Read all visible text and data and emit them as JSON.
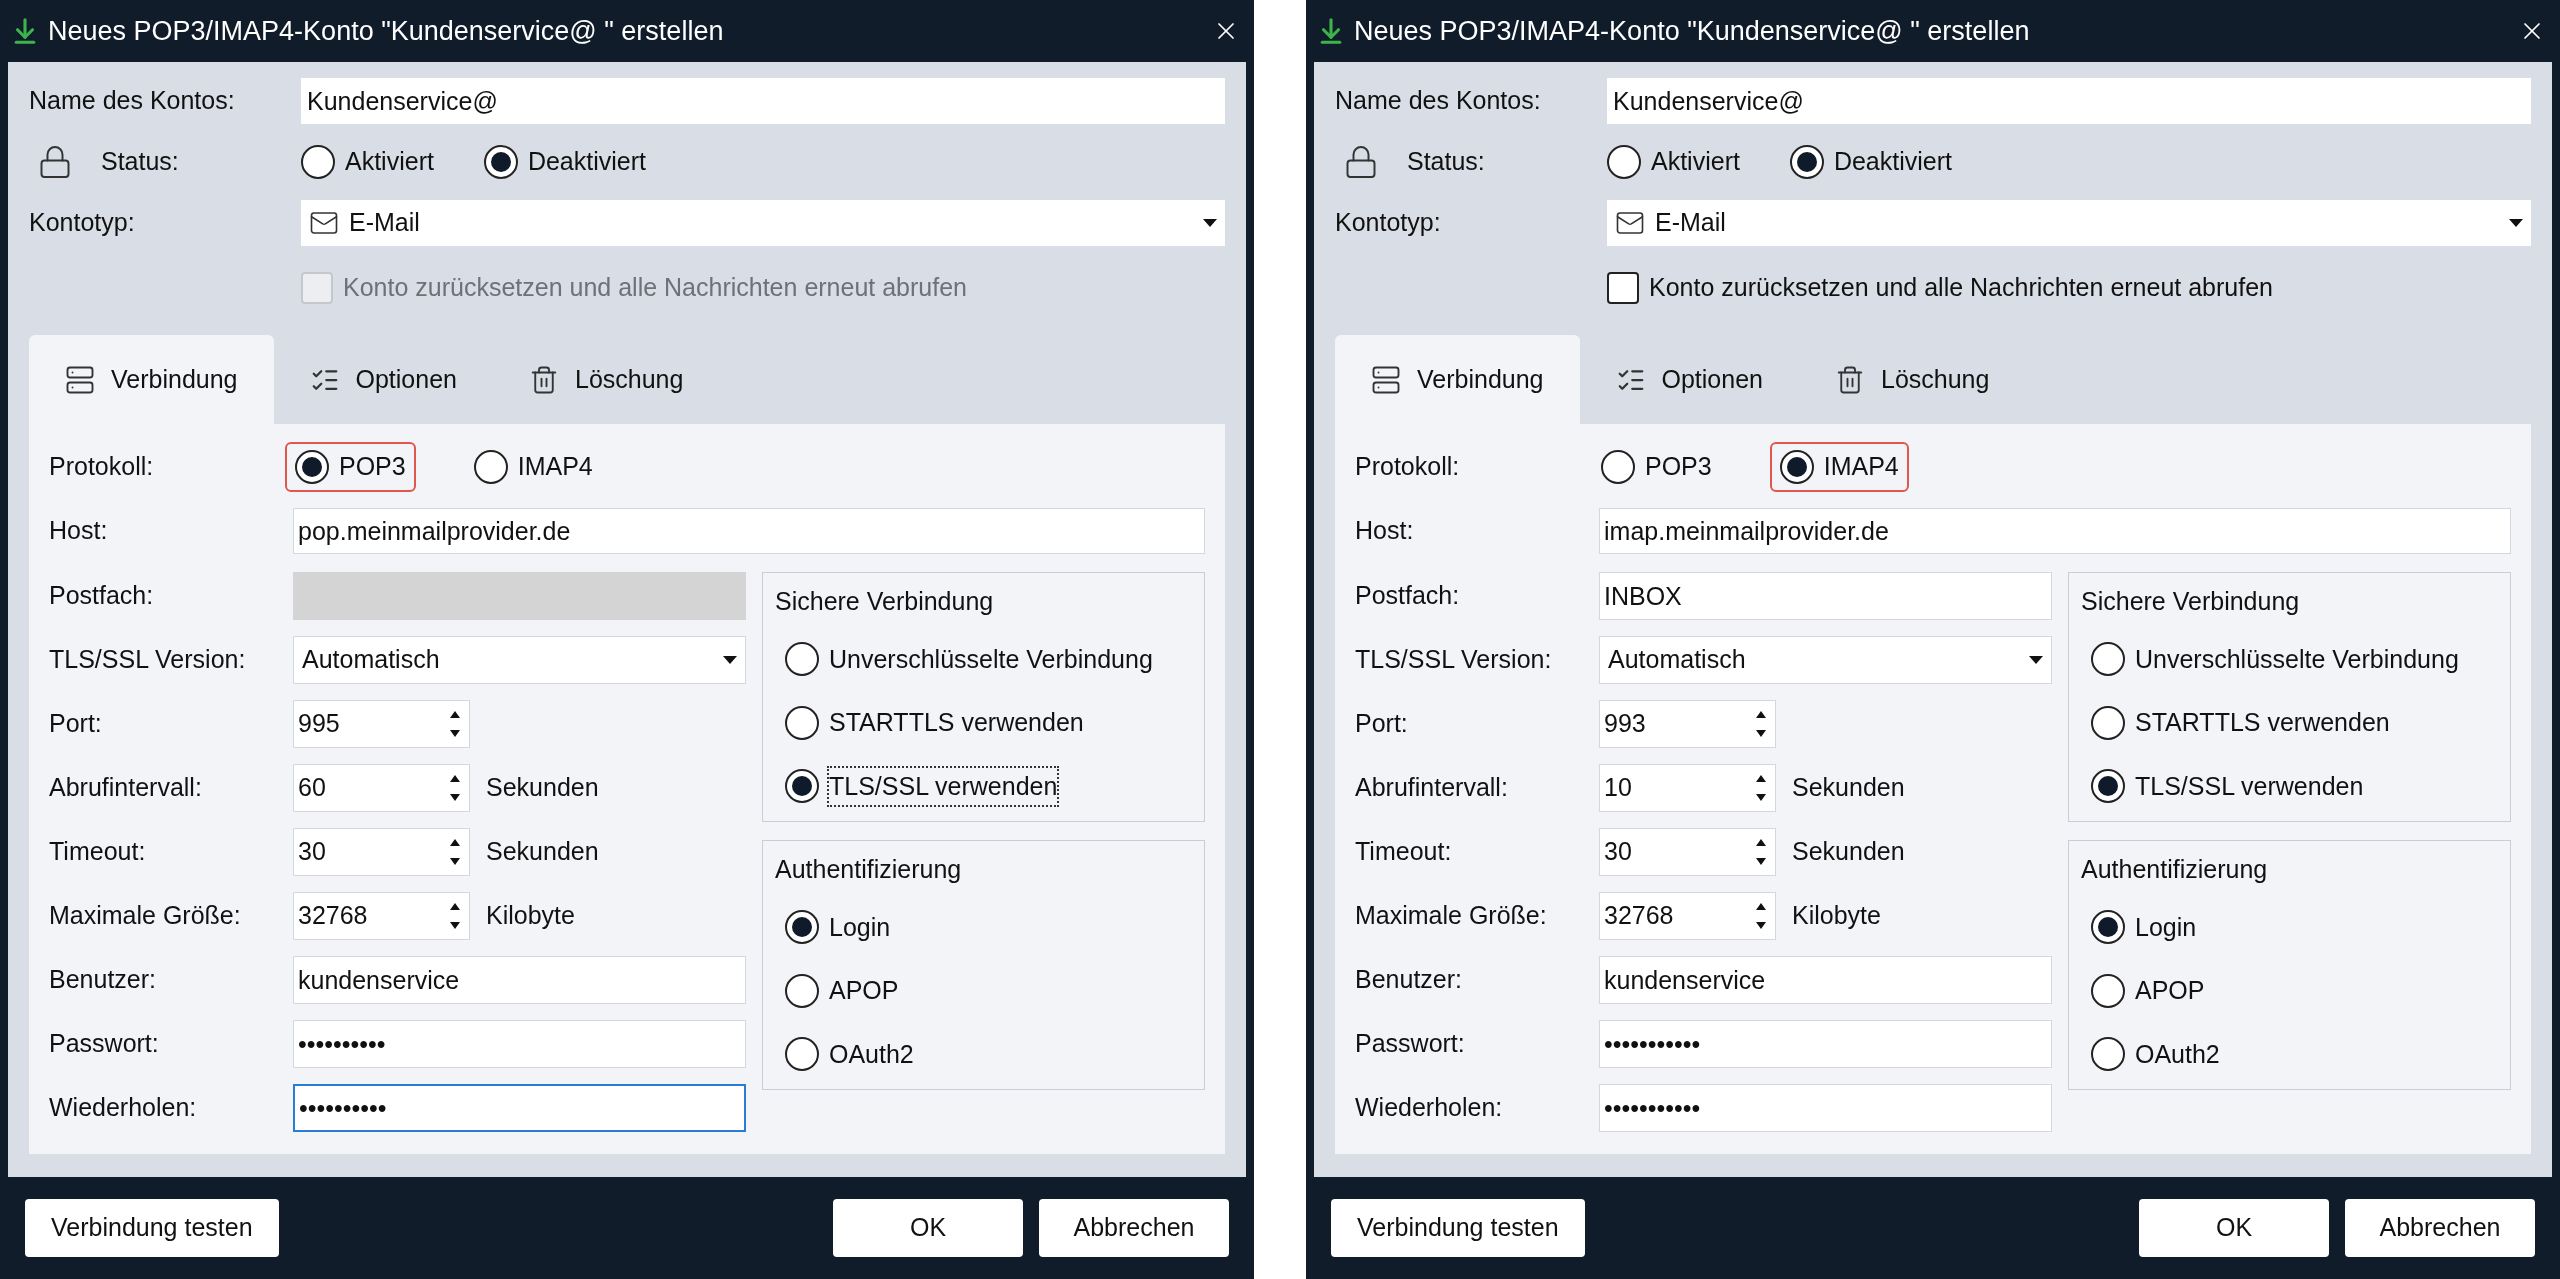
{
  "dialogs": [
    {
      "title": "Neues POP3/IMAP4-Konto \"Kundenservice@ \" erstellen",
      "account_name": {
        "label": "Name des Kontos:",
        "value": "Kundenservice@"
      },
      "status": {
        "label": "Status:",
        "options": [
          {
            "label": "Aktiviert",
            "selected": false
          },
          {
            "label": "Deaktiviert",
            "selected": true
          }
        ]
      },
      "account_type": {
        "label": "Kontotyp:",
        "value": "E-Mail"
      },
      "reset": {
        "label": "Konto zurücksetzen und alle Nachrichten erneut abrufen",
        "checked": false,
        "disabled": true
      },
      "tabs": [
        {
          "kind": "connection",
          "label": "Verbindung",
          "selected": true
        },
        {
          "kind": "options",
          "label": "Optionen",
          "selected": false
        },
        {
          "kind": "deletion",
          "label": "Löschung",
          "selected": false
        }
      ],
      "protocol": {
        "label": "Protokoll:",
        "options": [
          {
            "label": "POP3",
            "selected": true,
            "highlighted": true
          },
          {
            "label": "IMAP4",
            "selected": false,
            "highlighted": false
          }
        ]
      },
      "host": {
        "label": "Host:",
        "value": "pop.meinmailprovider.de"
      },
      "fields": [
        {
          "kind": "text",
          "label": "Postfach:",
          "disabled": true,
          "focused": false
        },
        {
          "kind": "dropdown",
          "label": "TLS/SSL Version:",
          "value": "Automatisch"
        },
        {
          "kind": "spinner",
          "label": "Port:",
          "value": "995"
        },
        {
          "kind": "spinner",
          "label": "Abrufintervall:",
          "value": "60",
          "unit": "Sekunden"
        },
        {
          "kind": "spinner",
          "label": "Timeout:",
          "value": "30",
          "unit": "Sekunden"
        },
        {
          "kind": "spinner",
          "label": "Maximale Größe:",
          "value": "32768",
          "unit": "Kilobyte"
        },
        {
          "kind": "text",
          "label": "Benutzer:",
          "value": "kundenservice",
          "disabled": false,
          "focused": false
        },
        {
          "kind": "text",
          "label": "Passwort:",
          "value": "••••••••••",
          "disabled": false,
          "focused": false
        },
        {
          "kind": "text",
          "label": "Wiederholen:",
          "value": "••••••••••",
          "disabled": false,
          "focused": true
        }
      ],
      "groups": [
        {
          "title": "Sichere Verbindung",
          "options": [
            {
              "label": "Unverschlüsselte Verbindung",
              "selected": false,
              "focused": false
            },
            {
              "label": "STARTTLS verwenden",
              "selected": false,
              "focused": false
            },
            {
              "label": "TLS/SSL verwenden",
              "selected": true,
              "focused": true
            }
          ]
        },
        {
          "title": "Authentifizierung",
          "options": [
            {
              "label": "Login",
              "selected": true,
              "focused": false
            },
            {
              "label": "APOP",
              "selected": false,
              "focused": false
            },
            {
              "label": "OAuth2",
              "selected": false,
              "focused": false
            }
          ]
        }
      ],
      "buttons_left": [
        "Verbindung testen"
      ],
      "buttons_right": [
        "OK",
        "Abbrechen"
      ]
    },
    {
      "title": "Neues POP3/IMAP4-Konto \"Kundenservice@ \" erstellen",
      "account_name": {
        "label": "Name des Kontos:",
        "value": "Kundenservice@"
      },
      "status": {
        "label": "Status:",
        "options": [
          {
            "label": "Aktiviert",
            "selected": false
          },
          {
            "label": "Deaktiviert",
            "selected": true
          }
        ]
      },
      "account_type": {
        "label": "Kontotyp:",
        "value": "E-Mail"
      },
      "reset": {
        "label": "Konto zurücksetzen und alle Nachrichten erneut abrufen",
        "checked": false,
        "disabled": false
      },
      "tabs": [
        {
          "kind": "connection",
          "label": "Verbindung",
          "selected": true
        },
        {
          "kind": "options",
          "label": "Optionen",
          "selected": false
        },
        {
          "kind": "deletion",
          "label": "Löschung",
          "selected": false
        }
      ],
      "protocol": {
        "label": "Protokoll:",
        "options": [
          {
            "label": "POP3",
            "selected": false,
            "highlighted": false
          },
          {
            "label": "IMAP4",
            "selected": true,
            "highlighted": true
          }
        ]
      },
      "host": {
        "label": "Host:",
        "value": "imap.meinmailprovider.de"
      },
      "fields": [
        {
          "kind": "text",
          "label": "Postfach:",
          "value": "INBOX",
          "disabled": false,
          "focused": false
        },
        {
          "kind": "dropdown",
          "label": "TLS/SSL Version:",
          "value": "Automatisch"
        },
        {
          "kind": "spinner",
          "label": "Port:",
          "value": "993"
        },
        {
          "kind": "spinner",
          "label": "Abrufintervall:",
          "value": "10",
          "unit": "Sekunden"
        },
        {
          "kind": "spinner",
          "label": "Timeout:",
          "value": "30",
          "unit": "Sekunden"
        },
        {
          "kind": "spinner",
          "label": "Maximale Größe:",
          "value": "32768",
          "unit": "Kilobyte"
        },
        {
          "kind": "text",
          "label": "Benutzer:",
          "value": "kundenservice",
          "disabled": false,
          "focused": false
        },
        {
          "kind": "text",
          "label": "Passwort:",
          "value": "•••••••••••",
          "disabled": false,
          "focused": false
        },
        {
          "kind": "text",
          "label": "Wiederholen:",
          "value": "•••••••••••",
          "disabled": false,
          "focused": false
        }
      ],
      "groups": [
        {
          "title": "Sichere Verbindung",
          "options": [
            {
              "label": "Unverschlüsselte Verbindung",
              "selected": false,
              "focused": false
            },
            {
              "label": "STARTTLS verwenden",
              "selected": false,
              "focused": false
            },
            {
              "label": "TLS/SSL verwenden",
              "selected": true,
              "focused": false
            }
          ]
        },
        {
          "title": "Authentifizierung",
          "options": [
            {
              "label": "Login",
              "selected": true,
              "focused": false
            },
            {
              "label": "APOP",
              "selected": false,
              "focused": false
            },
            {
              "label": "OAuth2",
              "selected": false,
              "focused": false
            }
          ]
        }
      ],
      "buttons_left": [
        "Verbindung testen"
      ],
      "buttons_right": [
        "OK",
        "Abbrechen"
      ]
    }
  ]
}
